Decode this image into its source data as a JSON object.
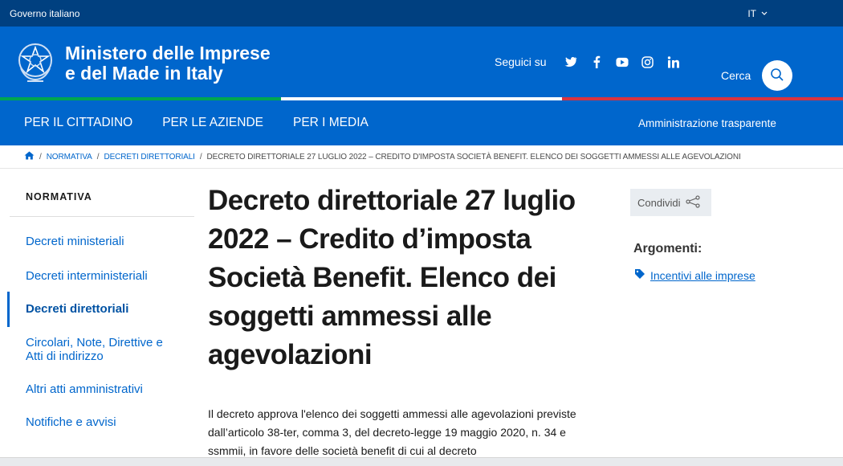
{
  "topbar": {
    "gov_label": "Governo italiano",
    "lang": "IT"
  },
  "header": {
    "title_line1": "Ministero delle Imprese",
    "title_line2": "e del Made in Italy",
    "follow_label": "Seguici su",
    "social_icons": [
      "twitter-icon",
      "facebook-icon",
      "youtube-icon",
      "instagram-icon",
      "linkedin-icon"
    ],
    "search_label": "Cerca"
  },
  "tricolor": {
    "green": "#00a651",
    "white": "#ffffff",
    "red": "#d9333f"
  },
  "nav": {
    "items": [
      "PER IL CITTADINO",
      "PER LE AZIENDE",
      "PER I MEDIA"
    ],
    "right": "Amministrazione trasparente"
  },
  "breadcrumb": {
    "items": [
      "NORMATIVA",
      "DECRETI DIRETTORIALI"
    ],
    "current": "DECRETO DIRETTORIALE 27 LUGLIO 2022 – CREDITO D'IMPOSTA SOCIETÀ BENEFIT. ELENCO DEI SOGGETTI AMMESSI ALLE AGEVOLAZIONI"
  },
  "sidebar": {
    "title": "NORMATIVA",
    "items": [
      {
        "label": "Decreti ministeriali"
      },
      {
        "label": "Decreti interministeriali"
      },
      {
        "label": "Decreti direttoriali"
      },
      {
        "label": "Circolari, Note, Direttive e Atti di indirizzo"
      },
      {
        "label": "Altri atti amministrativi"
      },
      {
        "label": "Notifiche e avvisi"
      }
    ]
  },
  "article": {
    "title": "Decreto direttoriale 27 luglio 2022 – Credito d’imposta Società Benefit. Elenco dei soggetti ammessi alle agevolazioni",
    "body": "Il decreto approva l'elenco dei soggetti ammessi alle agevolazioni previste dall’articolo 38-ter, comma 3, del decreto-legge 19 maggio 2020, n. 34 e ssmmii, in favore delle società benefit di cui al decreto"
  },
  "aside": {
    "share_label": "Condividi",
    "topics_title": "Argomenti:",
    "topic": "Incentivi alle imprese"
  },
  "colors": {
    "brand_dark": "#004080",
    "brand": "#0066cc"
  }
}
